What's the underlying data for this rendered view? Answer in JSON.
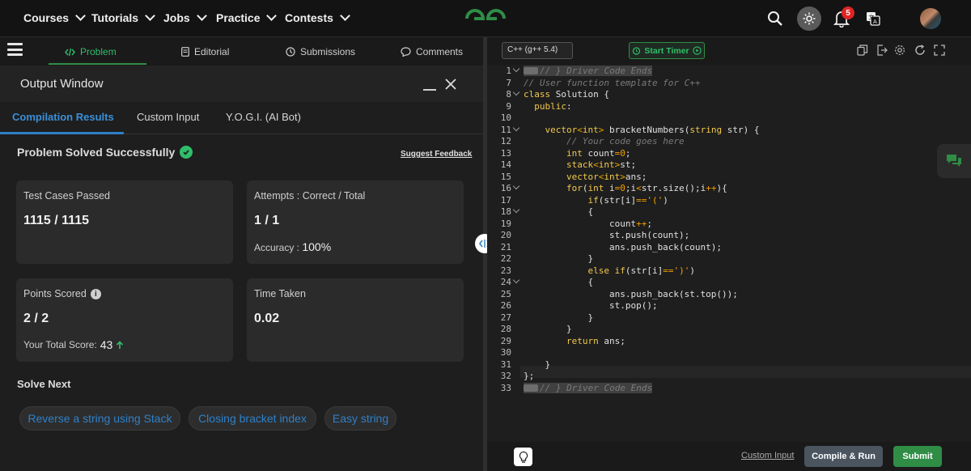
{
  "nav": {
    "items": [
      "Courses",
      "Tutorials",
      "Jobs",
      "Practice",
      "Contests"
    ],
    "notification_count": "5"
  },
  "problem_tabs": {
    "problem": "Problem",
    "editorial": "Editorial",
    "submissions": "Submissions",
    "comments": "Comments"
  },
  "output": {
    "title": "Output Window",
    "tabs": [
      "Compilation Results",
      "Custom Input",
      "Y.O.G.I. (AI Bot)"
    ],
    "status": "Problem Solved Successfully",
    "feedback_link": "Suggest Feedback",
    "test_cases": {
      "label": "Test Cases Passed",
      "value": "1115 / 1115"
    },
    "attempts": {
      "label": "Attempts : Correct / Total",
      "value": "1 / 1",
      "accuracy_label": "Accuracy :",
      "accuracy_value": "100%"
    },
    "points": {
      "label": "Points Scored",
      "value": "2 / 2",
      "total_label": "Your Total Score:",
      "total_value": "43"
    },
    "time": {
      "label": "Time Taken",
      "value": "0.02"
    },
    "solve_next_title": "Solve Next",
    "solve_next": [
      "Reverse a string using Stack",
      "Closing bracket index",
      "Easy string"
    ]
  },
  "editor": {
    "language": "C++ (g++ 5.4)",
    "timer_label": "Start Timer",
    "line_numbers": [
      "1",
      "7",
      "8",
      "9",
      "10",
      "11",
      "12",
      "13",
      "14",
      "15",
      "16",
      "17",
      "18",
      "19",
      "20",
      "21",
      "22",
      "23",
      "24",
      "25",
      "26",
      "27",
      "28",
      "29",
      "30",
      "31",
      "32",
      "33"
    ],
    "custom_input": "Custom Input",
    "compile_label": "Compile & Run",
    "submit_label": "Submit"
  },
  "colors": {
    "accent_green": "#2f8d46",
    "accent_blue": "#2f80c8",
    "notification_red": "#e02424"
  }
}
